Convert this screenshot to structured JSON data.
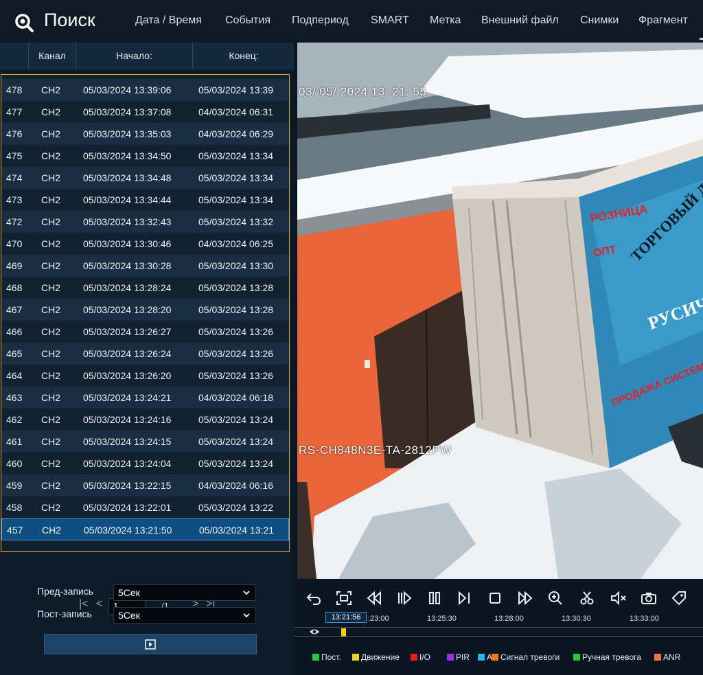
{
  "header": {
    "title": "Поиск",
    "menu": [
      "Дата / Время",
      "События",
      "Подпериод",
      "SMART",
      "Метка",
      "Внешний файл",
      "Снимки",
      "Фрагмент"
    ]
  },
  "table": {
    "columns": [
      "Канал",
      "Начало:",
      "Конец:"
    ],
    "rows": [
      {
        "num": "478",
        "ch": "CH2",
        "start": "05/03/2024 13:39:06",
        "end": "05/03/2024 13:39"
      },
      {
        "num": "477",
        "ch": "CH2",
        "start": "05/03/2024 13:37:08",
        "end": "04/03/2024 06:31"
      },
      {
        "num": "476",
        "ch": "CH2",
        "start": "05/03/2024 13:35:03",
        "end": "04/03/2024 06:29"
      },
      {
        "num": "475",
        "ch": "CH2",
        "start": "05/03/2024 13:34:50",
        "end": "05/03/2024 13:34"
      },
      {
        "num": "474",
        "ch": "CH2",
        "start": "05/03/2024 13:34:48",
        "end": "05/03/2024 13:34"
      },
      {
        "num": "473",
        "ch": "CH2",
        "start": "05/03/2024 13:34:44",
        "end": "05/03/2024 13:34"
      },
      {
        "num": "472",
        "ch": "CH2",
        "start": "05/03/2024 13:32:43",
        "end": "05/03/2024 13:32"
      },
      {
        "num": "470",
        "ch": "CH2",
        "start": "05/03/2024 13:30:46",
        "end": "04/03/2024 06:25"
      },
      {
        "num": "469",
        "ch": "CH2",
        "start": "05/03/2024 13:30:28",
        "end": "05/03/2024 13:30"
      },
      {
        "num": "468",
        "ch": "CH2",
        "start": "05/03/2024 13:28:24",
        "end": "05/03/2024 13:28"
      },
      {
        "num": "467",
        "ch": "CH2",
        "start": "05/03/2024 13:28:20",
        "end": "05/03/2024 13:28"
      },
      {
        "num": "466",
        "ch": "CH2",
        "start": "05/03/2024 13:26:27",
        "end": "05/03/2024 13:26"
      },
      {
        "num": "465",
        "ch": "CH2",
        "start": "05/03/2024 13:26:24",
        "end": "05/03/2024 13:26"
      },
      {
        "num": "464",
        "ch": "CH2",
        "start": "05/03/2024 13:26:20",
        "end": "05/03/2024 13:26"
      },
      {
        "num": "463",
        "ch": "CH2",
        "start": "05/03/2024 13:24:21",
        "end": "04/03/2024 06:18"
      },
      {
        "num": "462",
        "ch": "CH2",
        "start": "05/03/2024 13:24:16",
        "end": "05/03/2024 13:24"
      },
      {
        "num": "461",
        "ch": "CH2",
        "start": "05/03/2024 13:24:15",
        "end": "05/03/2024 13:24"
      },
      {
        "num": "460",
        "ch": "CH2",
        "start": "05/03/2024 13:24:04",
        "end": "05/03/2024 13:24"
      },
      {
        "num": "459",
        "ch": "CH2",
        "start": "05/03/2024 13:22:15",
        "end": "04/03/2024 06:16"
      },
      {
        "num": "458",
        "ch": "CH2",
        "start": "05/03/2024 13:22:01",
        "end": "05/03/2024 13:22"
      },
      {
        "num": "457",
        "ch": "CH2",
        "start": "05/03/2024 13:21:50",
        "end": "05/03/2024 13:21"
      }
    ],
    "selected_row": "457"
  },
  "pager": {
    "current": "1",
    "total": "/1"
  },
  "form": {
    "pre_label": "Пред-запись",
    "pre_value": "5Сек",
    "post_label": "Пост-запись",
    "post_value": "5Сек"
  },
  "video": {
    "timestamp": "03/ 05/ 2024  13: 21: 55",
    "camera_name": "RS-CH848N3E-TA-2812PW",
    "sign_text_1": "РОЗНИЦА",
    "sign_text_2": "ОПТ",
    "sign_text_3": "ТОРГОВЫЙ Д",
    "sign_text_4": "РУСИЧ",
    "sign_text_5": "ПРОДАЖА СИСТЕМ БЕЗ"
  },
  "timeline": {
    "current_time": "13:21:56",
    "ticks": [
      ":23:00",
      "13:25:30",
      "13:28:00",
      "13:30:30",
      "13:33:00"
    ]
  },
  "legend": [
    {
      "label": "Пост.",
      "color": "#22c93a"
    },
    {
      "label": "Движение",
      "color": "#e4d21e"
    },
    {
      "label": "I/O",
      "color": "#e02020"
    },
    {
      "label": "PIR",
      "color": "#9b2ee0"
    },
    {
      "label": "AI",
      "color": "#27b6e8"
    },
    {
      "label": "Сигнал тревоги",
      "color": "#f07a18"
    },
    {
      "label": "Ручная тревога",
      "color": "#22c93a"
    },
    {
      "label": "ANR",
      "color": "#f0704a"
    }
  ],
  "icons": [
    "search-icon",
    "back-icon",
    "fullscreen-icon",
    "rewind-icon",
    "step-back-icon",
    "pause-icon",
    "step-forward-icon",
    "stop-icon",
    "fast-forward-icon",
    "zoom-icon",
    "cut-icon",
    "mute-icon",
    "snapshot-icon",
    "tag-icon",
    "eye-icon",
    "play-icon"
  ]
}
